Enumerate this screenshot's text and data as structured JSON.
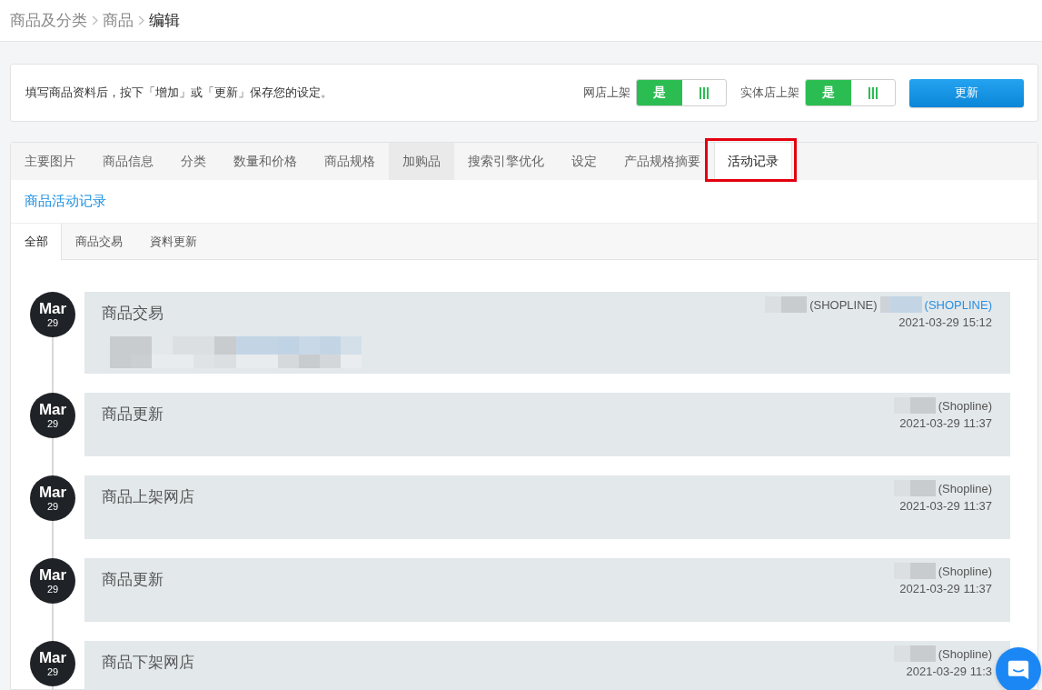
{
  "breadcrumb": [
    {
      "label": "商品及分类",
      "current": false
    },
    {
      "label": "商品",
      "current": false
    },
    {
      "label": "编辑",
      "current": true
    }
  ],
  "notice": {
    "text": "填写商品资料后，按下「增加」或「更新」保存您的设定。",
    "toggles": [
      {
        "label": "网店上架",
        "value": "是",
        "on": true
      },
      {
        "label": "实体店上架",
        "value": "是",
        "on": true
      }
    ],
    "save_button": "更新"
  },
  "tabs": [
    {
      "label": "主要图片",
      "selected": false,
      "hovered": false,
      "highlighted": false
    },
    {
      "label": "商品信息",
      "selected": false,
      "hovered": false,
      "highlighted": false
    },
    {
      "label": "分类",
      "selected": false,
      "hovered": false,
      "highlighted": false
    },
    {
      "label": "数量和价格",
      "selected": false,
      "hovered": false,
      "highlighted": false
    },
    {
      "label": "商品规格",
      "selected": false,
      "hovered": false,
      "highlighted": false
    },
    {
      "label": "加购品",
      "selected": false,
      "hovered": true,
      "highlighted": false
    },
    {
      "label": "搜索引擎优化",
      "selected": false,
      "hovered": false,
      "highlighted": false
    },
    {
      "label": "设定",
      "selected": false,
      "hovered": false,
      "highlighted": false
    },
    {
      "label": "产品规格摘要",
      "selected": false,
      "hovered": false,
      "highlighted": false
    },
    {
      "label": "活动记录",
      "selected": true,
      "hovered": false,
      "highlighted": true
    }
  ],
  "section_title": "商品活动记录",
  "sub_tabs": [
    {
      "label": "全部",
      "selected": true
    },
    {
      "label": "商品交易",
      "selected": false
    },
    {
      "label": "資料更新",
      "selected": false
    }
  ],
  "entries": [
    {
      "month": "Mar",
      "day": "29",
      "title": "商品交易",
      "authors": [
        {
          "org": "(SHOPLINE)",
          "link": false
        },
        {
          "org": "(SHOPLINE)",
          "link": true
        }
      ],
      "time": "2021-03-29 15:12",
      "redacted_details": true
    },
    {
      "month": "Mar",
      "day": "29",
      "title": "商品更新",
      "authors": [
        {
          "org": "(Shopline)",
          "link": false
        }
      ],
      "time": "2021-03-29 11:37",
      "redacted_details": false
    },
    {
      "month": "Mar",
      "day": "29",
      "title": "商品上架网店",
      "authors": [
        {
          "org": "(Shopline)",
          "link": false
        }
      ],
      "time": "2021-03-29 11:37",
      "redacted_details": false
    },
    {
      "month": "Mar",
      "day": "29",
      "title": "商品更新",
      "authors": [
        {
          "org": "(Shopline)",
          "link": false
        }
      ],
      "time": "2021-03-29 11:37",
      "redacted_details": false
    },
    {
      "month": "Mar",
      "day": "29",
      "title": "商品下架网店",
      "authors": [
        {
          "org": "(Shopline)",
          "link": false
        }
      ],
      "time": "2021-03-29 11:3",
      "redacted_details": false
    }
  ]
}
